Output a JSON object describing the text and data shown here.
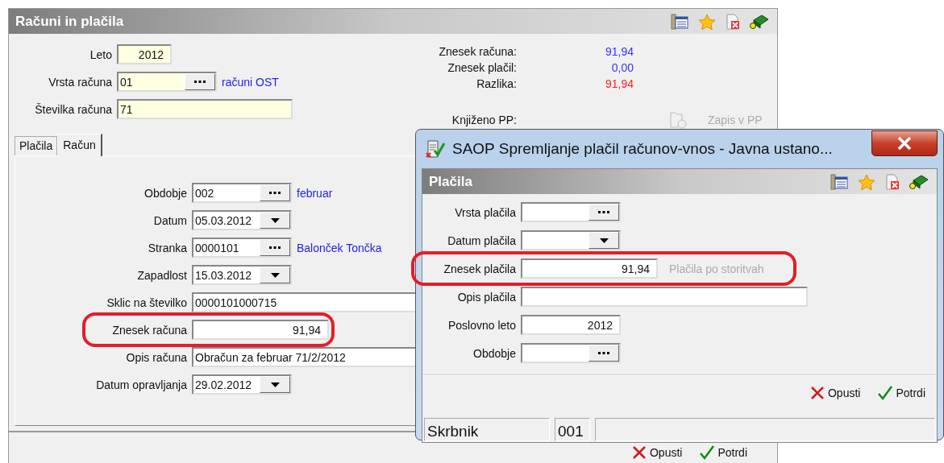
{
  "main_window": {
    "title": "Računi in plačila",
    "header_fields": [
      {
        "label": "Leto",
        "value": "2012",
        "kind": "year"
      },
      {
        "label": "Vrsta računa",
        "value": "01",
        "kind": "lookup",
        "note": "računi OST"
      },
      {
        "label": "Številka računa",
        "value": "71",
        "kind": "wide"
      }
    ],
    "summary": [
      {
        "label": "Znesek računa:",
        "value": "91,94",
        "color": "#3333ff"
      },
      {
        "label": "Znesek plačil:",
        "value": "0,00",
        "color": "#3333ff"
      },
      {
        "label": "Razlika:",
        "value": "91,94",
        "color": "#ff2020"
      }
    ],
    "posted": {
      "label": "Knjiženo PP:",
      "button": "Zapis v PP",
      "disabled": true
    },
    "tabs": [
      {
        "label": "Plačila",
        "selected": false
      },
      {
        "label": "Račun",
        "selected": true
      }
    ],
    "fields": [
      {
        "label": "Obdobje",
        "value": "002",
        "kind": "lookup",
        "note": "februar",
        "highlighted": false
      },
      {
        "label": "Datum",
        "value": "05.03.2012",
        "kind": "date",
        "highlighted": false
      },
      {
        "label": "Stranka",
        "value": "0000101",
        "kind": "lookup",
        "note": "Balonček Tončka",
        "highlighted": false
      },
      {
        "label": "Zapadlost",
        "value": "15.03.2012",
        "kind": "date",
        "highlighted": false
      },
      {
        "label": "Sklic na številko",
        "value": "0000101000715",
        "kind": "wide",
        "highlighted": false
      },
      {
        "label": "Znesek računa",
        "value": "91,94",
        "kind": "amount",
        "highlighted": true
      },
      {
        "label": "Opis računa",
        "value": "Obračun za februar 71/2/2012",
        "kind": "wide",
        "highlighted": false
      },
      {
        "label": "Datum opravljanja",
        "value": "29.02.2012",
        "kind": "date",
        "highlighted": false
      }
    ],
    "buttons": [
      {
        "label": "Opusti",
        "kind": "cancel"
      },
      {
        "label": "Potrdi",
        "kind": "ok"
      }
    ]
  },
  "dialog": {
    "title": "SAOP Spremljanje plačil računov-vnos - Javna ustano...",
    "heading": "Plačila",
    "fields": [
      {
        "label": "Vrsta plačila",
        "kind": "lookup",
        "highlighted": false
      },
      {
        "label": "Datum plačila",
        "kind": "date",
        "highlighted": false
      },
      {
        "label": "Znesek plačila",
        "value": "91,94",
        "kind": "amount",
        "highlighted": true,
        "side_button": {
          "label": "Plačila po storitvah",
          "disabled": true
        }
      },
      {
        "label": "Opis plačila",
        "kind": "wide",
        "highlighted": false
      },
      {
        "label": "Poslovno leto",
        "value": "2012",
        "kind": "number",
        "highlighted": false
      },
      {
        "label": "Obdobje",
        "kind": "lookup",
        "highlighted": false
      }
    ],
    "buttons": [
      {
        "label": "Opusti",
        "kind": "cancel"
      },
      {
        "label": "Potrdi",
        "kind": "ok"
      }
    ],
    "status_bar": [
      "Skrbnik",
      "001"
    ]
  }
}
